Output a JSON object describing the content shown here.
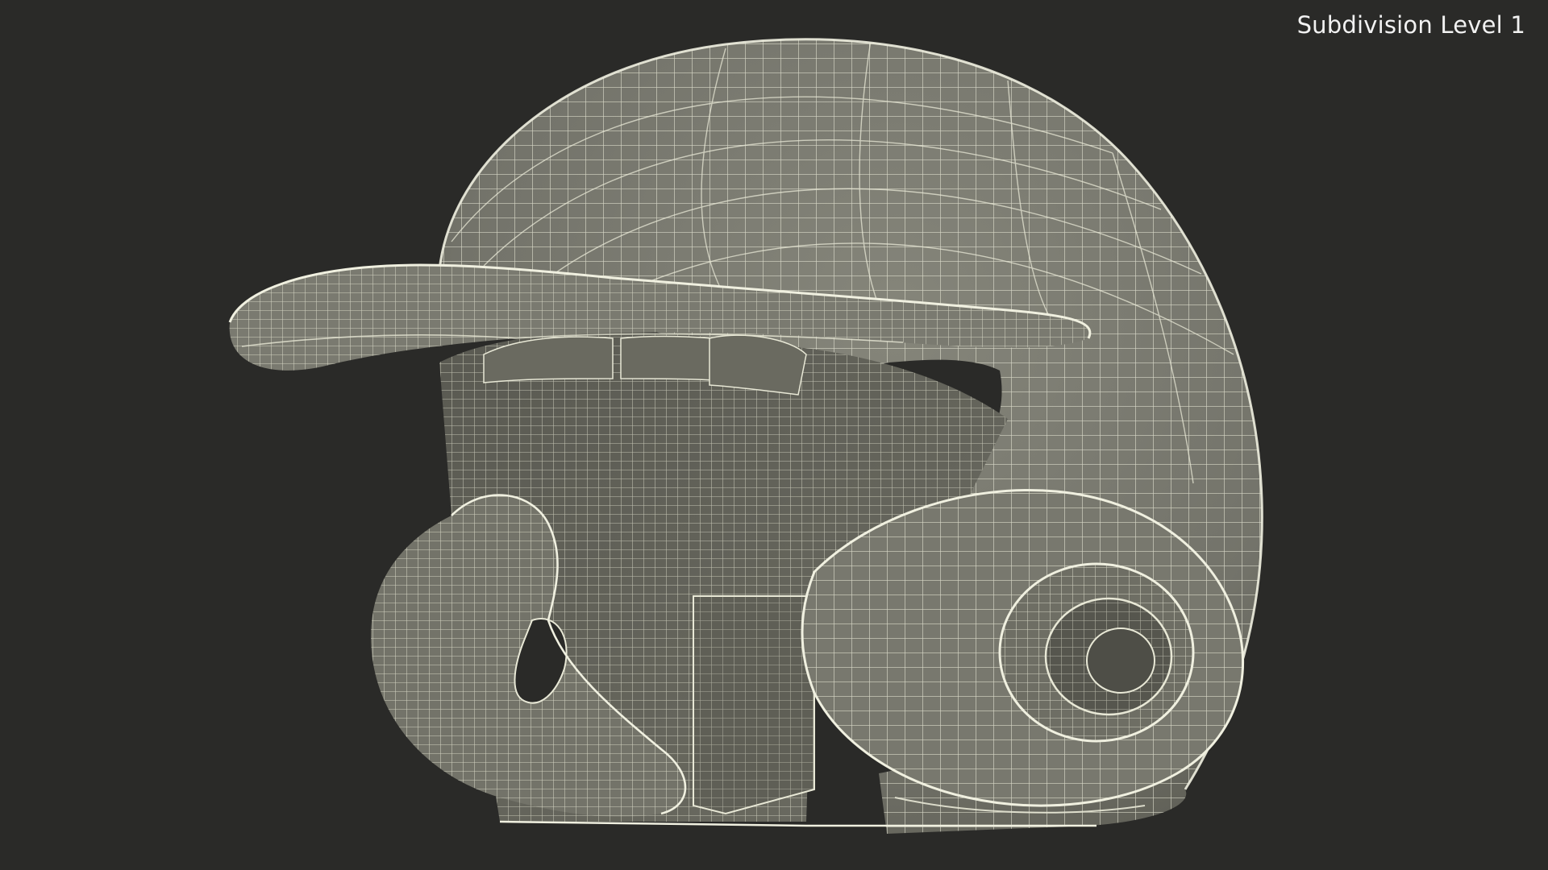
{
  "viewport": {
    "label": "Subdivision Level 1",
    "background": "#2a2a28"
  },
  "model": {
    "object": "baseball-batting-helmet",
    "display_mode": "wireframe-on-shaded",
    "surface_color": "#747468",
    "surface_shadow_color": "#5c5c52",
    "wire_color": "#e8e8d6"
  }
}
